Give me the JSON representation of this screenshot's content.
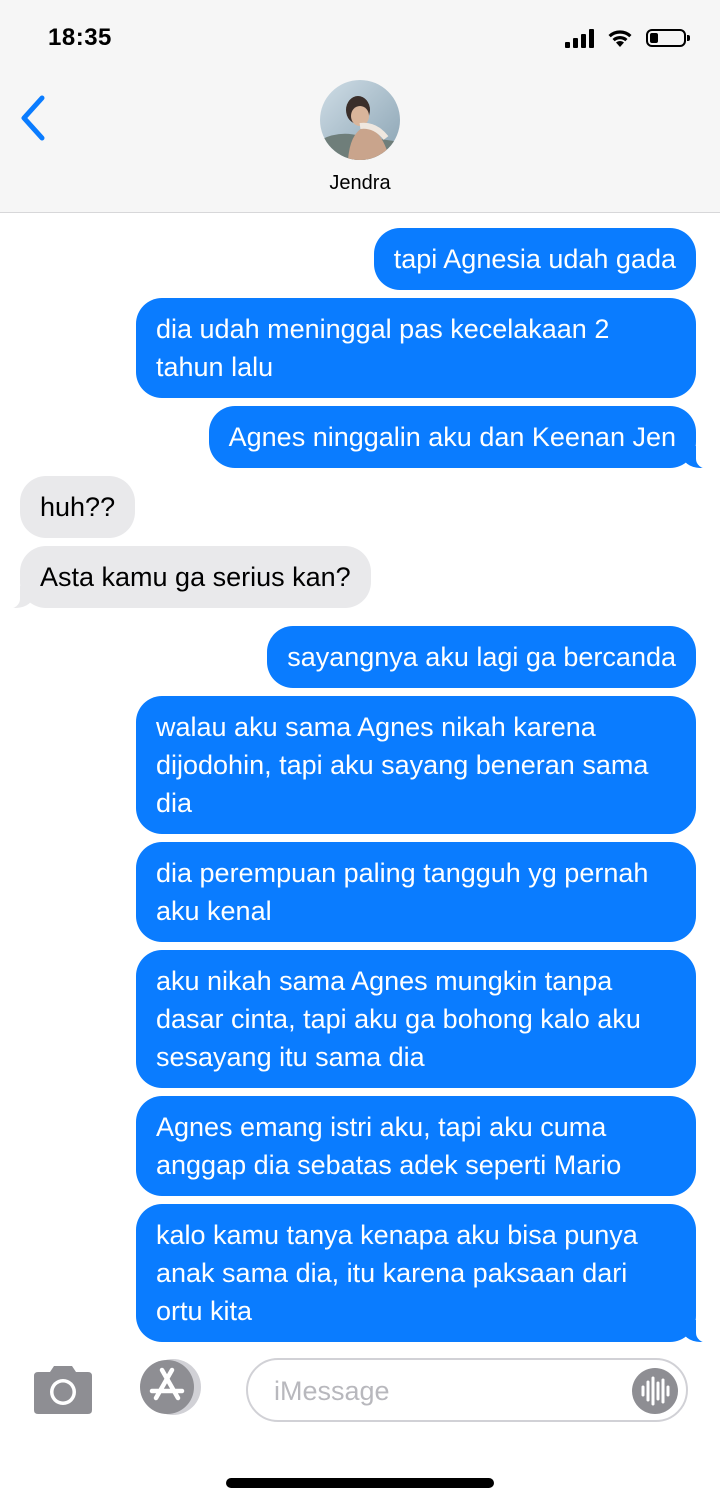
{
  "status_bar": {
    "time": "18:35",
    "battery_level_fraction": 0.2
  },
  "header": {
    "contact_name": "Jendra",
    "back_icon": "chevron-left-icon",
    "avatar_icon": "contact-avatar"
  },
  "messages": [
    {
      "direction": "outgoing",
      "text": "tapi Agnesia udah gada"
    },
    {
      "direction": "outgoing",
      "text": "dia udah meninggal pas kecelakaan 2 tahun lalu"
    },
    {
      "direction": "outgoing",
      "text": "Agnes ninggalin aku dan Keenan Jen"
    },
    {
      "direction": "incoming",
      "text": "huh??"
    },
    {
      "direction": "incoming",
      "text": "Asta kamu ga serius kan?"
    },
    {
      "direction": "outgoing",
      "text": "sayangnya aku lagi ga bercanda"
    },
    {
      "direction": "outgoing",
      "text": "walau aku sama Agnes nikah karena dijodohin, tapi aku sayang beneran sama dia"
    },
    {
      "direction": "outgoing",
      "text": "dia perempuan paling tangguh yg pernah aku kenal"
    },
    {
      "direction": "outgoing",
      "text": "aku nikah sama Agnes mungkin tanpa dasar cinta, tapi aku ga bohong kalo aku sesayang itu sama dia"
    },
    {
      "direction": "outgoing",
      "text": "Agnes emang istri aku, tapi aku cuma anggap dia sebatas adek seperti Mario"
    },
    {
      "direction": "outgoing",
      "text": "kalo kamu tanya kenapa aku bisa punya anak sama dia, itu karena paksaan dari ortu kita"
    }
  ],
  "input_bar": {
    "placeholder": "iMessage",
    "value": "",
    "camera_icon": "camera-icon",
    "apps_icon": "app-store-icon",
    "audio_icon": "audio-waveform-icon"
  },
  "colors": {
    "outgoing_bubble": "#0a7cff",
    "incoming_bubble": "#e9e9eb",
    "accent": "#0a7cff",
    "header_bg": "#f6f6f6"
  }
}
